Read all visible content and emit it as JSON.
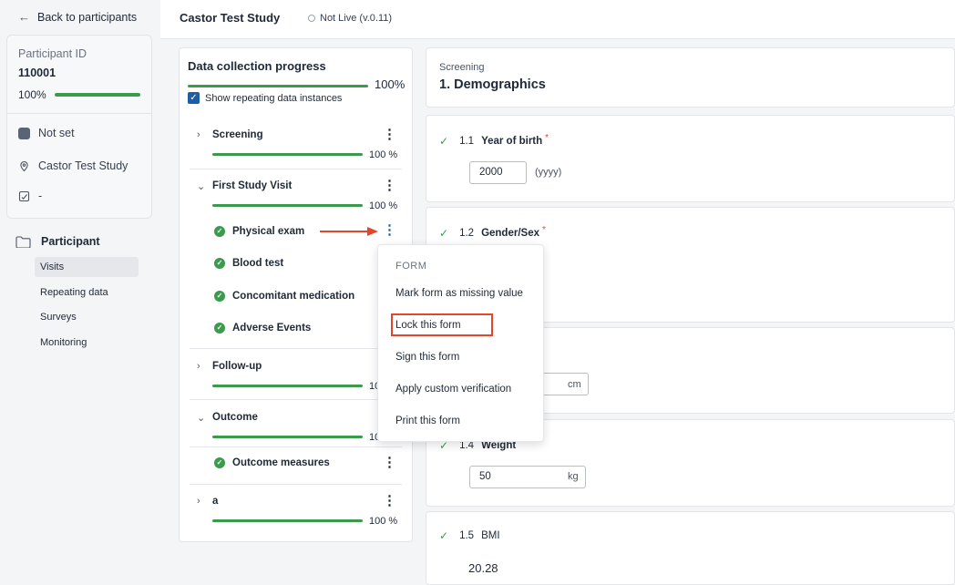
{
  "nav": {
    "back_label": "Back to participants"
  },
  "participant": {
    "id_label": "Participant ID",
    "id_value": "110001",
    "progress_text": "100%",
    "progress_fraction": 1.0,
    "status": "Not set",
    "study": "Castor Test Study",
    "sign_status": "-"
  },
  "sidebar": {
    "section_label": "Participant",
    "items": [
      {
        "label": "Visits",
        "active": true
      },
      {
        "label": "Repeating data",
        "active": false
      },
      {
        "label": "Surveys",
        "active": false
      },
      {
        "label": "Monitoring",
        "active": false
      }
    ]
  },
  "header": {
    "study_title": "Castor Test Study",
    "study_status": "Not Live (v.0.11)"
  },
  "progress": {
    "title": "Data collection progress",
    "overall_pct": "100%",
    "show_repeating_label": "Show repeating data instances",
    "show_repeating_checked": true,
    "sections": [
      {
        "name": "Screening",
        "pct": "100 %",
        "expanded": false
      },
      {
        "name": "First Study Visit",
        "pct": "100 %",
        "expanded": true,
        "forms": [
          "Physical exam",
          "Blood test",
          "Concomitant medication",
          "Adverse Events"
        ]
      },
      {
        "name": "Follow-up",
        "pct": "100 %",
        "expanded": false
      },
      {
        "name": "Outcome",
        "pct": "100 %",
        "expanded": true,
        "forms": [
          "Outcome measures"
        ]
      },
      {
        "name": "a",
        "pct": "100 %",
        "expanded": false
      }
    ]
  },
  "menu": {
    "header": "FORM",
    "items": [
      "Mark form as missing value",
      "Lock this form",
      "Sign this form",
      "Apply custom verification",
      "Print this form"
    ],
    "highlighted": "Lock this form"
  },
  "form": {
    "overline": "Screening",
    "title": "1. Demographics",
    "fields": [
      {
        "num": "1.1",
        "label": "Year of birth",
        "required": true,
        "value": "2000",
        "hint": "(yyyy)"
      },
      {
        "num": "1.2",
        "label": "Gender/Sex",
        "required": true
      },
      {
        "unit": "cm"
      },
      {
        "num": "1.4",
        "label": "Weight",
        "required": true,
        "value": "50",
        "unit": "kg"
      },
      {
        "num": "1.5",
        "label": "BMI",
        "required": false,
        "value": "20.28"
      }
    ]
  },
  "colors": {
    "accent_green": "#3b9a4e",
    "accent_blue": "#1d5fa7",
    "highlight_red": "#e2462b"
  }
}
